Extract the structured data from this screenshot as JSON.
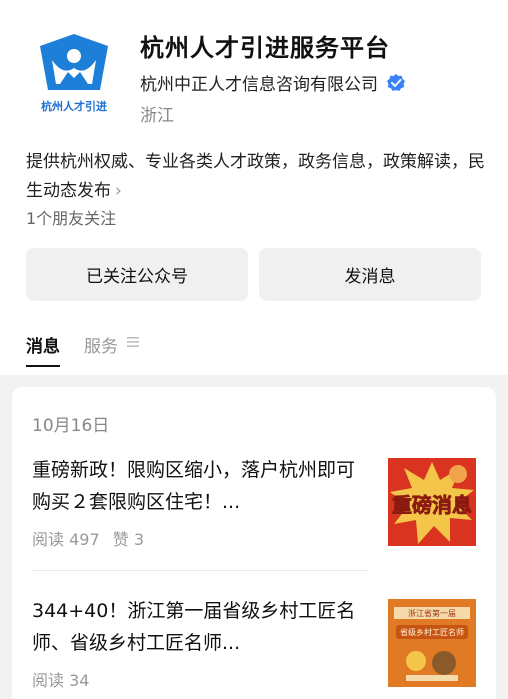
{
  "account": {
    "name": "杭州人才引进服务平台",
    "company": "杭州中正人才信息咨询有限公司",
    "region": "浙江",
    "logo_text": "杭州人才引进",
    "description": "提供杭州权威、专业各类人才政策，政务信息，政策解读，民生动态发布",
    "friends": "1个朋友关注"
  },
  "buttons": {
    "follow": "已关注公众号",
    "message": "发消息"
  },
  "tabs": [
    "消息",
    "服务"
  ],
  "feed": {
    "date": "10月16日",
    "articles": [
      {
        "title": "重磅新政！限购区缩小，落户杭州即可购买２套限购区住宅！...",
        "reads": "阅读 497",
        "likes": "赞 3",
        "thumb_text": "重磅消息"
      },
      {
        "title": "344+40！浙江第一届省级乡村工匠名师、省级乡村工匠名师...",
        "reads": "阅读 34",
        "thumb_text": "浙江省第一届",
        "thumb_text2": "省级乡村工匠名师"
      }
    ]
  },
  "colors": {
    "logo_blue": "#1e7fd9",
    "verified_blue": "#3a82f7",
    "thumb_red": "#d93420",
    "thumb_orange": "#e07a24"
  }
}
